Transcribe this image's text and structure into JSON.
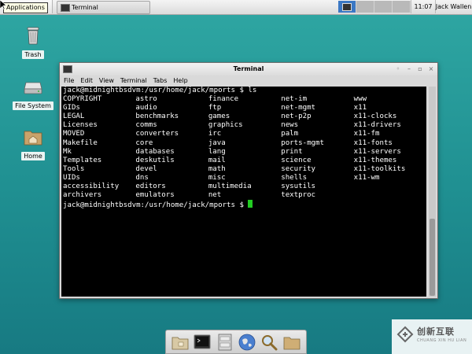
{
  "panel": {
    "applications_label": "Applications",
    "taskbar_item": "Terminal",
    "clock": "11:07",
    "user": "Jack Wallen"
  },
  "desktop": {
    "icons": [
      {
        "label": "Trash",
        "icon": "trash-icon"
      },
      {
        "label": "File System",
        "icon": "drive-icon"
      },
      {
        "label": "Home",
        "icon": "home-folder-icon"
      }
    ]
  },
  "window": {
    "title": "Terminal",
    "menu": [
      "File",
      "Edit",
      "View",
      "Terminal",
      "Tabs",
      "Help"
    ],
    "prompt1": "jack@midnightbsdvm:/usr/home/jack/mports $ ls",
    "ls_rows": [
      [
        "COPYRIGHT",
        "astro",
        "finance",
        "net-im",
        "www"
      ],
      [
        "GIDs",
        "audio",
        "ftp",
        "net-mgmt",
        "x11"
      ],
      [
        "LEGAL",
        "benchmarks",
        "games",
        "net-p2p",
        "x11-clocks"
      ],
      [
        "Licenses",
        "comms",
        "graphics",
        "news",
        "x11-drivers"
      ],
      [
        "MOVED",
        "converters",
        "irc",
        "palm",
        "x11-fm"
      ],
      [
        "Makefile",
        "core",
        "java",
        "ports-mgmt",
        "x11-fonts"
      ],
      [
        "Mk",
        "databases",
        "lang",
        "print",
        "x11-servers"
      ],
      [
        "Templates",
        "deskutils",
        "mail",
        "science",
        "x11-themes"
      ],
      [
        "Tools",
        "devel",
        "math",
        "security",
        "x11-toolkits"
      ],
      [
        "UIDs",
        "dns",
        "misc",
        "shells",
        "x11-wm"
      ],
      [
        "accessibility",
        "editors",
        "multimedia",
        "sysutils",
        ""
      ],
      [
        "archivers",
        "emulators",
        "net",
        "textproc",
        ""
      ]
    ],
    "prompt2": "jack@midnightbsdvm:/usr/home/jack/mports $ "
  },
  "watermark": {
    "text": "创新互联",
    "sub": "CHUANG XIN HU LIAN"
  },
  "colors": {
    "desktop": "#1f8f91",
    "terminal_bg": "#000000",
    "cursor": "#22cc22",
    "active_workspace": "#3b78c4"
  }
}
